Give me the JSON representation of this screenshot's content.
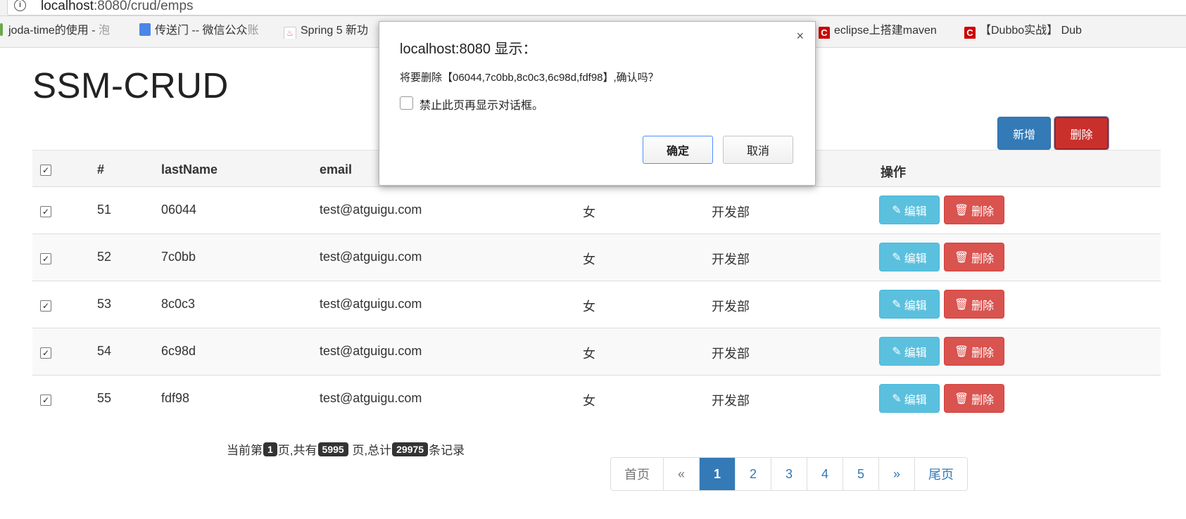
{
  "browser": {
    "url_host": "localhost",
    "url_path": ":8080/crud/emps",
    "bookmarks": [
      {
        "label": "joda-time的使用 - ",
        "fade": "泡",
        "color": "#6aa84f"
      },
      {
        "label": "传送门 -- 微信公众",
        "fade": "账",
        "color": "#4a86e8"
      },
      {
        "label": "Spring 5 新功",
        "fade": "",
        "color": "#e06666"
      },
      {
        "label": "eclipse上搭建maven",
        "fade": "",
        "color": "#cc0000"
      },
      {
        "label": "【Dubbo实战】 Dub",
        "fade": "",
        "color": "#cc0000"
      }
    ]
  },
  "page": {
    "title": "SSM-CRUD",
    "add_label": "新增",
    "delete_label": "删除"
  },
  "table": {
    "headers": {
      "number": "#",
      "last_name": "lastName",
      "email": "email",
      "ops": "操作"
    },
    "edit_label": "编辑",
    "delete_label": "删除",
    "rows": [
      {
        "id": "51",
        "last_name": "06044",
        "email": "test@atguigu.com",
        "gender": "女",
        "dept": "开发部"
      },
      {
        "id": "52",
        "last_name": "7c0bb",
        "email": "test@atguigu.com",
        "gender": "女",
        "dept": "开发部"
      },
      {
        "id": "53",
        "last_name": "8c0c3",
        "email": "test@atguigu.com",
        "gender": "女",
        "dept": "开发部"
      },
      {
        "id": "54",
        "last_name": "6c98d",
        "email": "test@atguigu.com",
        "gender": "女",
        "dept": "开发部"
      },
      {
        "id": "55",
        "last_name": "fdf98",
        "email": "test@atguigu.com",
        "gender": "女",
        "dept": "开发部"
      }
    ]
  },
  "page_info": {
    "prefix": "当前第",
    "current": "1",
    "mid1": "页,共有",
    "total_pages": "5995",
    "mid2": " 页,总计",
    "total_records": "29975",
    "suffix": "条记录"
  },
  "pagination": {
    "first": "首页",
    "prev": "«",
    "pages": [
      "1",
      "2",
      "3",
      "4",
      "5"
    ],
    "next": "»",
    "last": "尾页",
    "active": "1"
  },
  "dialog": {
    "title": "localhost:8080 显示：",
    "message": "将要删除【06044,7c0bb,8c0c3,6c98d,fdf98】,确认吗？",
    "checkbox_label": "禁止此页再显示对话框。",
    "ok_label": "确定",
    "cancel_label": "取消",
    "close_glyph": "×"
  },
  "colors": {
    "primary": "#337ab7",
    "danger": "#d9534f",
    "info": "#5bc0de"
  }
}
